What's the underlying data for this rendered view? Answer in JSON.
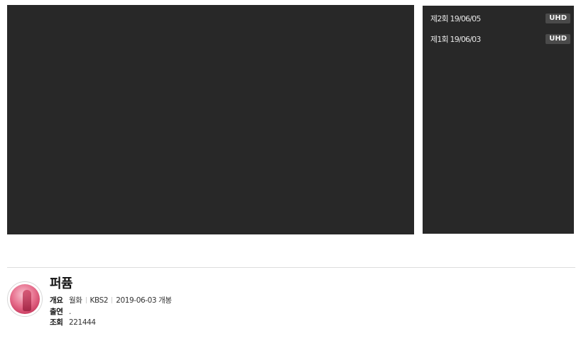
{
  "episodes": [
    {
      "title": "제2회 19/06/05",
      "badge": "UHD"
    },
    {
      "title": "제1회 19/06/03",
      "badge": "UHD"
    }
  ],
  "program": {
    "title": "퍼퓸",
    "overview_label": "개요",
    "schedule": "월화",
    "channel": "KBS2",
    "premiere": "2019-06-03 개봉",
    "cast_label": "출연",
    "cast": ".",
    "views_label": "조회",
    "views": "221444"
  },
  "colors": {
    "player_bg": "#282828",
    "panel_bg": "#282828",
    "badge_bg": "#4a4a4a"
  }
}
